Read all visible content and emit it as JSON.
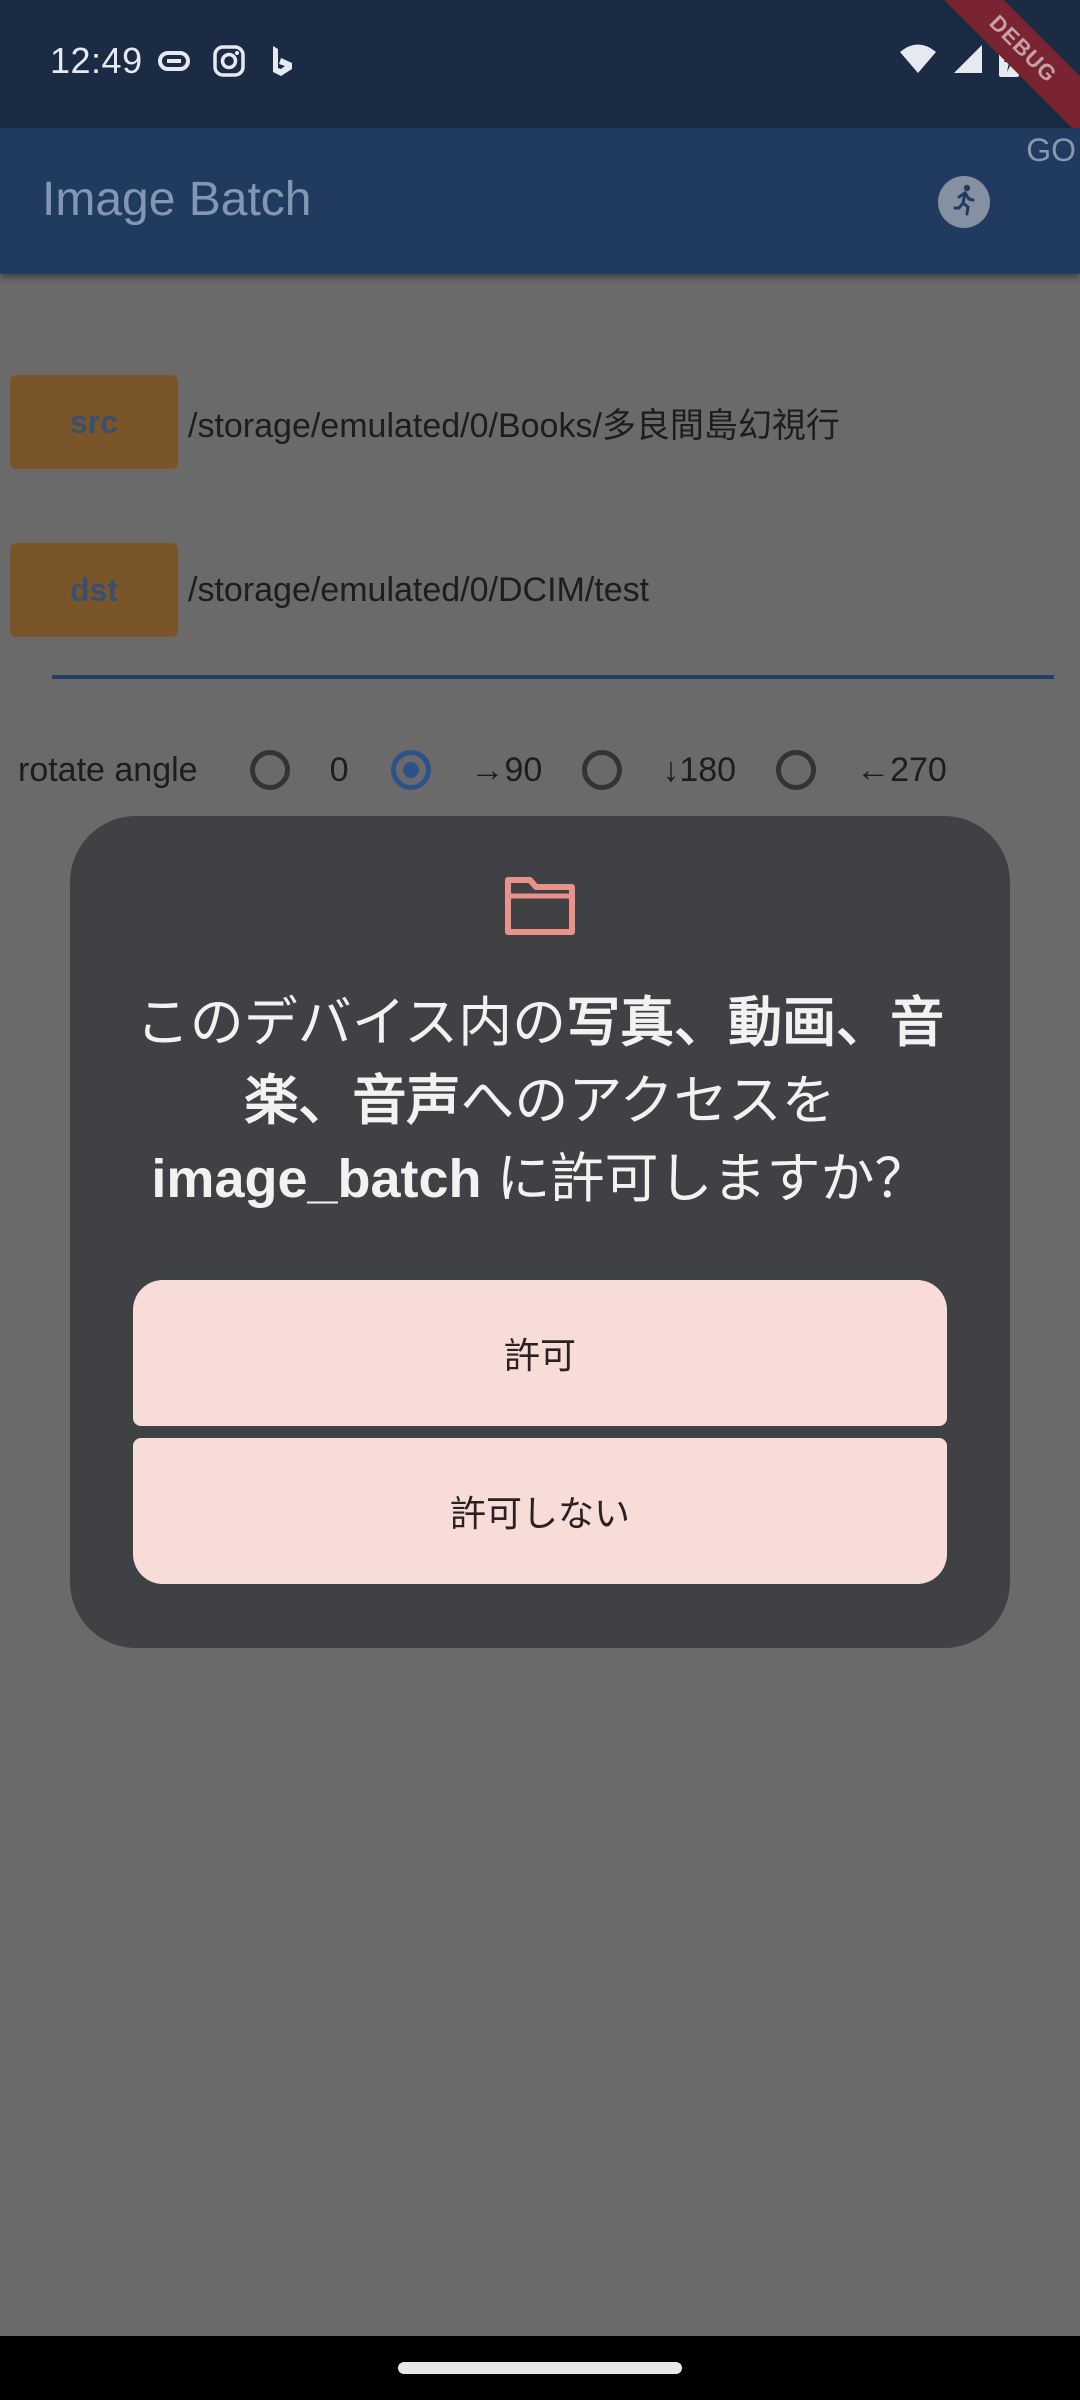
{
  "status_bar": {
    "time": "12:49",
    "left_icons": [
      "pill-icon",
      "instagram-icon",
      "bing-icon"
    ],
    "right_icons": [
      "wifi-icon",
      "signal-icon",
      "battery-charging-icon"
    ],
    "debug_banner": "DEBUG"
  },
  "app_bar": {
    "title": "Image Batch",
    "go_label": "GO",
    "action_icon": "run-icon"
  },
  "main": {
    "src_button": "src",
    "src_path": "/storage/emulated/0/Books/多良間島幻視行",
    "dst_button": "dst",
    "dst_path": "/storage/emulated/0/DCIM/test",
    "rotate_label": "rotate angle",
    "rotate_options": [
      {
        "label": "0",
        "selected": false
      },
      {
        "label": "→90",
        "selected": true
      },
      {
        "label": "↓180",
        "selected": false
      },
      {
        "label": "←270",
        "selected": false
      }
    ]
  },
  "dialog": {
    "icon": "folder-icon",
    "message_parts": [
      "このデバイス内の",
      "写真、動画、音楽、音声",
      "へのアクセスを",
      "image_batch",
      " に許可しますか？"
    ],
    "allow_label": "許可",
    "deny_label": "許可しない"
  },
  "colors": {
    "status_bar": "#1c2b44",
    "app_bar": "#203b5f",
    "scrim_background": "#6a6a6a",
    "dialog_bg": "#3f4144",
    "dialog_button": "#f8dcd8",
    "folder_icon": "#e8928a"
  }
}
